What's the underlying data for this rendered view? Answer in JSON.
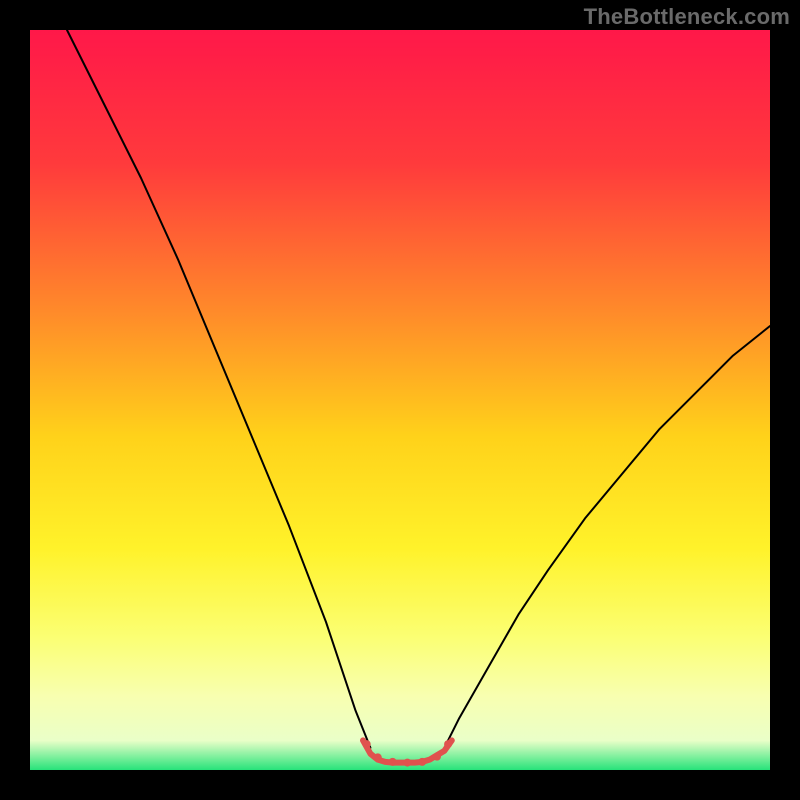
{
  "watermark": "TheBottleneck.com",
  "chart_data": {
    "type": "line",
    "title": "",
    "xlabel": "",
    "ylabel": "",
    "xlim": [
      0,
      100
    ],
    "ylim": [
      0,
      100
    ],
    "background_gradient": {
      "stops": [
        {
          "offset": 0,
          "color": "#ff1849"
        },
        {
          "offset": 18,
          "color": "#ff3a3c"
        },
        {
          "offset": 38,
          "color": "#ff8a2a"
        },
        {
          "offset": 55,
          "color": "#ffd21a"
        },
        {
          "offset": 70,
          "color": "#fff22a"
        },
        {
          "offset": 82,
          "color": "#fbff73"
        },
        {
          "offset": 90,
          "color": "#f8ffb0"
        },
        {
          "offset": 96,
          "color": "#eaffc8"
        },
        {
          "offset": 100,
          "color": "#27e37a"
        }
      ]
    },
    "series": [
      {
        "name": "curve-left",
        "color": "#000000",
        "width": 2,
        "x": [
          5,
          10,
          15,
          20,
          25,
          30,
          35,
          40,
          44,
          46
        ],
        "y": [
          100,
          90,
          80,
          69,
          57,
          45,
          33,
          20,
          8,
          3
        ]
      },
      {
        "name": "curve-right",
        "color": "#000000",
        "width": 2,
        "x": [
          56,
          58,
          62,
          66,
          70,
          75,
          80,
          85,
          90,
          95,
          100
        ],
        "y": [
          3,
          7,
          14,
          21,
          27,
          34,
          40,
          46,
          51,
          56,
          60
        ]
      },
      {
        "name": "trough-marker",
        "color": "#e0524e",
        "width": 6,
        "x": [
          45,
          46,
          47,
          48,
          49,
          50,
          51,
          52,
          53,
          54,
          55,
          56,
          57
        ],
        "y": [
          4,
          2.2,
          1.4,
          1.1,
          1.0,
          1.0,
          1.0,
          1.0,
          1.1,
          1.4,
          2.0,
          2.6,
          4
        ]
      }
    ],
    "trough_dots": {
      "color": "#e0524e",
      "radius": 4,
      "points": [
        {
          "x": 45.5,
          "y": 3.5
        },
        {
          "x": 47.0,
          "y": 1.7
        },
        {
          "x": 49.0,
          "y": 1.1
        },
        {
          "x": 51.0,
          "y": 1.0
        },
        {
          "x": 53.0,
          "y": 1.1
        },
        {
          "x": 55.0,
          "y": 1.8
        },
        {
          "x": 56.5,
          "y": 3.5
        }
      ]
    }
  }
}
